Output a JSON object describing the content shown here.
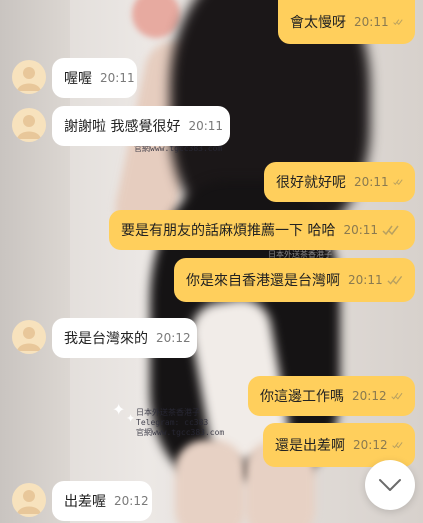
{
  "messages": [
    {
      "text": "會太慢呀",
      "time": "20:11",
      "side": "out"
    },
    {
      "text": "喔喔",
      "time": "20:11",
      "side": "in"
    },
    {
      "text": "謝謝啦 我感覺很好",
      "time": "20:11",
      "side": "in"
    },
    {
      "text": "很好就好呢",
      "time": "20:11",
      "side": "out"
    },
    {
      "text": "要是有朋友的話麻煩推薦一下 哈哈",
      "time": "20:11",
      "side": "out"
    },
    {
      "text": "你是來自香港還是台灣啊",
      "time": "20:11",
      "side": "out"
    },
    {
      "text": "我是台灣來的",
      "time": "20:12",
      "side": "in"
    },
    {
      "text": "你這邊工作嗎",
      "time": "20:12",
      "side": "out"
    },
    {
      "text": "還是出差啊",
      "time": "20:12",
      "side": "out"
    },
    {
      "text": "出差喔",
      "time": "20:12",
      "side": "in"
    }
  ],
  "watermarks": {
    "top": "官網www.tgcc383.com",
    "mid": "日本外送茶香港子\ntelegram: cc383\n官網www.tgcc383.com",
    "bottom": "日本外送茶香港子\nTelegram: cc383\n官網www.tgcc383.com"
  },
  "icons": {
    "read_check": "double-check-icon",
    "avatar": "user-avatar-icon",
    "scroll_down": "chevron-down-icon"
  },
  "colors": {
    "outgoing_bubble": "#ffcf5c",
    "incoming_bubble": "#ffffff",
    "avatar_bg": "#f7e2bd"
  }
}
